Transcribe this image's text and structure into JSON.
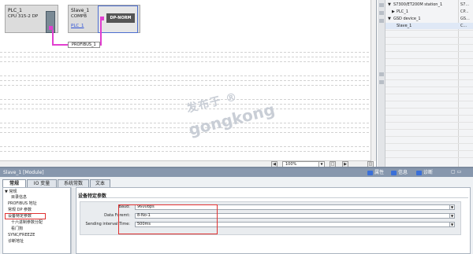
{
  "network": {
    "plc": {
      "name": "PLC_1",
      "type": "CPU 315-2 DP"
    },
    "slave": {
      "name": "Slave_1",
      "type": "COMPB",
      "link": "PLC_1",
      "module": "DP-NORM"
    },
    "bus_label": "PROFIBUS_1",
    "zoom_value": "100%"
  },
  "tree": {
    "rows": [
      {
        "text": "S7300/ET200M station_1",
        "col": "S7..."
      },
      {
        "text": "PLC_1",
        "col": "CP..."
      },
      {
        "text": "GSD device_1",
        "col": "GS..."
      },
      {
        "text": "Slave_1",
        "col": "C..."
      }
    ]
  },
  "inspector": {
    "title": "Slave_1 [Module]",
    "right_tabs": [
      {
        "label": "属性",
        "icon_color": "#3a6fd8",
        "icon": "properties-icon"
      },
      {
        "label": "信息",
        "icon_color": "#3a6fd8",
        "icon": "info-icon"
      },
      {
        "label": "诊断",
        "icon_color": "#3a6fd8",
        "icon": "diagnostics-icon"
      }
    ],
    "tabs": [
      {
        "label": "常规",
        "active": true
      },
      {
        "label": "IO 变量",
        "active": false
      },
      {
        "label": "系统常数",
        "active": false
      },
      {
        "label": "文本",
        "active": false
      }
    ],
    "nav": {
      "root": "常规",
      "items": [
        "目录信息",
        "PROFIBUS 地址",
        "常规 DP 参数",
        "设备特定参数",
        "十六进制参数分配",
        "看门狗",
        "SYNC/FREEZE",
        "诊断地址"
      ]
    },
    "section_title": "设备特定参数",
    "params": [
      {
        "label": "Baud:",
        "value": "9600bps"
      },
      {
        "label": "Data Foremt:",
        "value": "8-No-1"
      },
      {
        "label": "Sending interval Time:",
        "value": "500ms"
      }
    ]
  },
  "colors": {
    "profibus": "#e23fd0",
    "highlight": "#e03131",
    "inspector_header": "#8797ad"
  },
  "watermark": {
    "line1": "发布于 ®",
    "line2": "gongkong"
  }
}
